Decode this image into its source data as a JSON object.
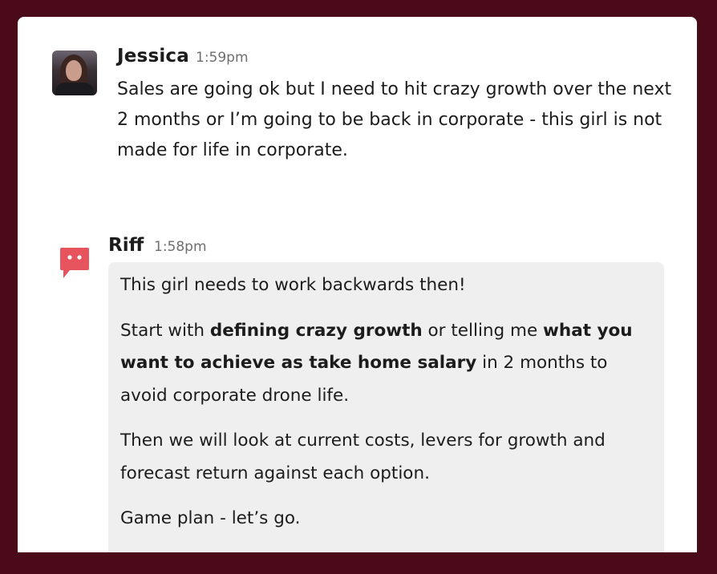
{
  "messages": [
    {
      "sender": "Jessica",
      "time": "1:59pm",
      "avatar": "user-photo",
      "text": "Sales are going ok but I need to hit crazy growth over the next 2 months or I’m going to be back in corporate - this girl is not made for life in corporate."
    },
    {
      "sender": "Riff",
      "time": "1:58pm",
      "avatar": "riff-bot-icon",
      "paragraphs": [
        [
          {
            "text": "This girl needs to work backwards then!",
            "bold": false
          }
        ],
        [
          {
            "text": "Start with ",
            "bold": false
          },
          {
            "text": "defining crazy growth",
            "bold": true
          },
          {
            "text": " or telling me ",
            "bold": false
          },
          {
            "text": "what you want to achieve as take home salary",
            "bold": true
          },
          {
            "text": " in 2 months to avoid corporate drone life.",
            "bold": false
          }
        ],
        [
          {
            "text": "Then we will look at current costs, levers for growth and forecast return against each option.",
            "bold": false
          }
        ],
        [
          {
            "text": "Game plan - let’s go.",
            "bold": false
          }
        ]
      ]
    }
  ],
  "colors": {
    "frame": "#4a0a1a",
    "panel": "#ffffff",
    "bubble": "#efefef",
    "riff_icon": "#e8545e",
    "text": "#1d1c1d",
    "timestamp": "#6e6e6e"
  }
}
